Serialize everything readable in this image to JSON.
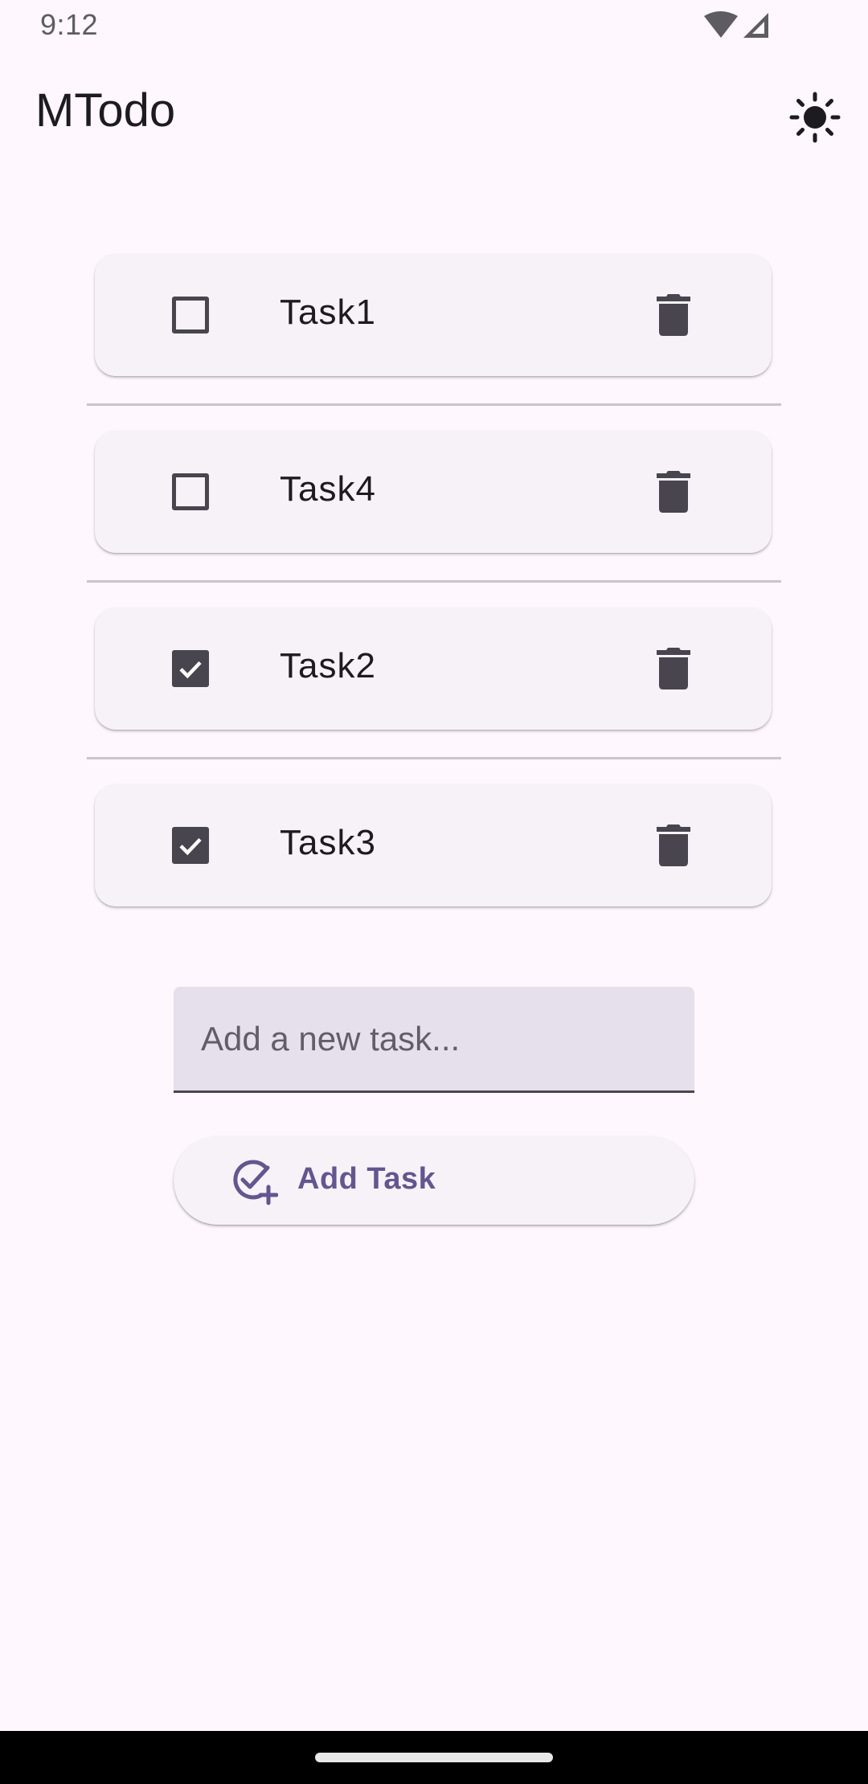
{
  "status_bar": {
    "time": "9:12",
    "icons": [
      "wifi-icon",
      "cellular-signal-icon"
    ]
  },
  "app_bar": {
    "title": "MTodo",
    "theme_icon": "sun-icon"
  },
  "tasks": [
    {
      "label": "Task1",
      "checked": false
    },
    {
      "label": "Task4",
      "checked": false
    },
    {
      "label": "Task2",
      "checked": true
    },
    {
      "label": "Task3",
      "checked": true
    }
  ],
  "new_task": {
    "value": "",
    "placeholder": "Add a new task..."
  },
  "add_button": {
    "label": "Add Task",
    "icon": "add-task-icon"
  },
  "colors": {
    "background": "#fef7fd",
    "card": "#f6f2f8",
    "on_surface_variant": "#49454f",
    "primary": "#65558f",
    "input_fill": "#e6e0ec"
  }
}
